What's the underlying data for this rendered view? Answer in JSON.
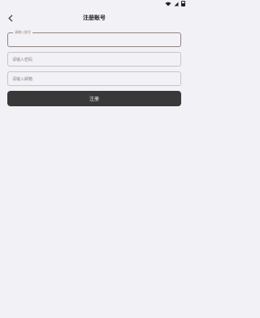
{
  "nav": {
    "title": "注册账号",
    "back_icon": "chevron-left-icon"
  },
  "form": {
    "account_label": "请输入账号",
    "password_placeholder": "请输入密码",
    "email_placeholder": "请输入邮箱",
    "register_label": "注册"
  },
  "status_bar": {
    "icons": [
      "wifi-icon",
      "signal-icon",
      "battery-icon"
    ]
  }
}
